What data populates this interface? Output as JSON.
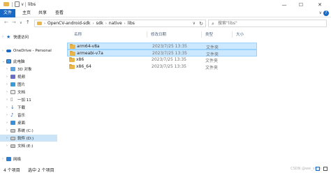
{
  "window": {
    "title": "libs",
    "quick_access_arrow": "∨",
    "minimize": "—",
    "maximize": "☐",
    "close": "✕"
  },
  "ribbon": {
    "tabs": [
      "文件",
      "主页",
      "共享",
      "查看"
    ],
    "expand": "∨",
    "help": "?"
  },
  "nav": {
    "back": "←",
    "forward": "→",
    "recent": "∨",
    "up": "↑",
    "breadcrumb": [
      "OpenCV-android-sdk",
      "sdk",
      "native",
      "libs"
    ],
    "dropdown": "∨",
    "refresh": "↻"
  },
  "search": {
    "placeholder": "搜索\"libs\""
  },
  "sidebar": {
    "items": [
      {
        "label": "快速访问",
        "icon": "star-icon"
      },
      {
        "label": "OneDrive - Personal",
        "icon": "cloud-icon"
      },
      {
        "label": "此电脑",
        "icon": "pc-icon"
      },
      {
        "label": "3D 对象",
        "icon": "cube-icon"
      },
      {
        "label": "视频",
        "icon": "video-icon"
      },
      {
        "label": "图片",
        "icon": "picture-icon"
      },
      {
        "label": "文档",
        "icon": "document-icon"
      },
      {
        "label": "一加 11",
        "icon": "phone-icon"
      },
      {
        "label": "下载",
        "icon": "download-icon"
      },
      {
        "label": "音乐",
        "icon": "music-icon"
      },
      {
        "label": "桌面",
        "icon": "desktop-icon"
      },
      {
        "label": "系统 (C:)",
        "icon": "drive-icon"
      },
      {
        "label": "软件 (D:)",
        "icon": "drive-icon"
      },
      {
        "label": "文档 (E:)",
        "icon": "drive-icon"
      },
      {
        "label": "网络",
        "icon": "network-icon"
      }
    ]
  },
  "columns": {
    "name": "名称",
    "date": "修改日期",
    "type": "类型",
    "size": "大小"
  },
  "files": [
    {
      "name": "arm64-v8a",
      "date": "2023/7/25 13:35",
      "type": "文件夹"
    },
    {
      "name": "armeabi-v7a",
      "date": "2023/7/25 13:35",
      "type": "文件夹"
    },
    {
      "name": "x86",
      "date": "2023/7/25 13:35",
      "type": "文件夹"
    },
    {
      "name": "x86_64",
      "date": "2023/7/25 13:35",
      "type": "文件夹"
    }
  ],
  "status": {
    "count": "4 个项目",
    "selected": "选中 2 个项目",
    "watermark": "CSDN @wei_shuo"
  },
  "colors": {
    "accent": "#1a69c4",
    "selection": "#cce8ff",
    "folder": "#e8b64c"
  }
}
